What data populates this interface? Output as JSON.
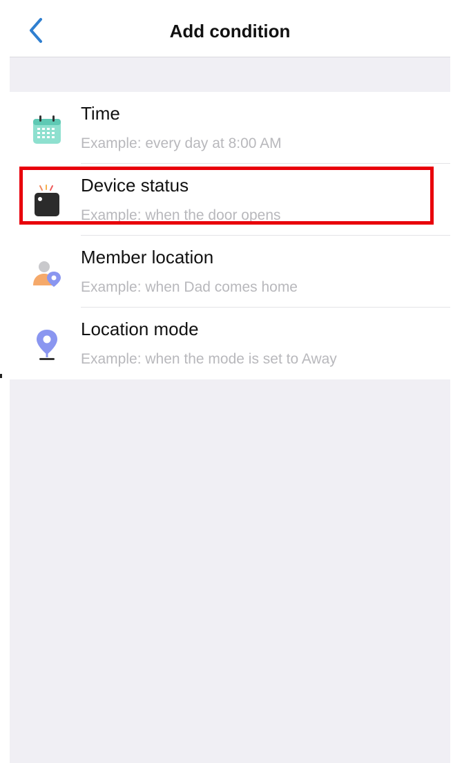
{
  "header": {
    "title": "Add condition",
    "back_icon": "chevron-left-icon"
  },
  "conditions": [
    {
      "title": "Time",
      "subtitle": "Example: every day at 8:00 AM",
      "icon": "calendar-icon"
    },
    {
      "title": "Device status",
      "subtitle": "Example: when the door opens",
      "icon": "device-icon",
      "highlighted": true
    },
    {
      "title": "Member location",
      "subtitle": "Example: when Dad comes home",
      "icon": "member-location-icon"
    },
    {
      "title": "Location mode",
      "subtitle": "Example: when the mode is set to Away",
      "icon": "location-pin-icon"
    }
  ],
  "colors": {
    "accent": "#2f7fd0",
    "highlight": "#e8000b",
    "background": "#f0eff4",
    "subtitle": "#b8b8bc"
  }
}
